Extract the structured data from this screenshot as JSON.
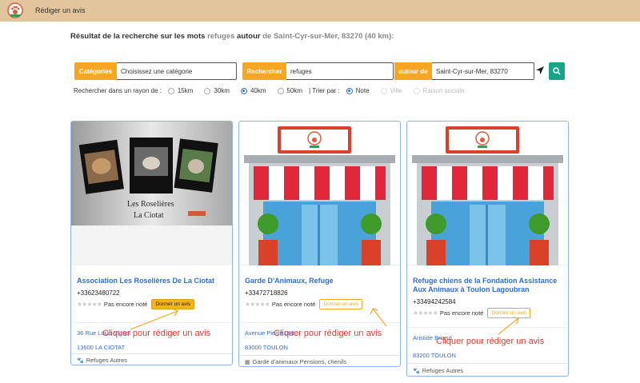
{
  "topbar": {
    "link": "Rédiger un avis",
    "accent": "#e2c59c"
  },
  "result": {
    "prefix": "Résultat de la recherche sur les mots",
    "keyword": "refuges",
    "middle": "autour",
    "place": "de Saint-Cyr-sur-Mer, 83270 (40 km):"
  },
  "search": {
    "categories_label": "Catégories",
    "categories_value": "Choisissez une catégorie",
    "search_label": "Rechercher",
    "search_value": "refuges",
    "around_label": "autour de",
    "around_value": "Saint-Cyr-sur-Mer, 83270",
    "accent": "#f5a623",
    "button_color": "#17a589"
  },
  "filters": {
    "radius_label": "Rechercher dans un rayon de :",
    "radii": [
      "15km",
      "30km",
      "40km",
      "50km"
    ],
    "radius_selected": "40km",
    "sort_label": "|  Trier par :",
    "sorts": [
      "Note",
      "Ville",
      "Raison sociale"
    ],
    "sort_selected": "Note"
  },
  "cards": [
    {
      "title": "Association Les Roselières De La Ciotat",
      "phone": "+33623480722",
      "rating_text": "Pas encore noté",
      "button": "Donner un avis",
      "street": "36 Rue Louis Vignol",
      "city": "13600 LA CIOTAT",
      "category": "Refuges Autres",
      "img_text_1": "Les Roselières",
      "img_text_2": "La Ciotat"
    },
    {
      "title": "Garde D'Animaux, Refuge",
      "phone": "+33472718826",
      "rating_text": "Pas encore noté",
      "button": "Donner un avis",
      "street": "Avenue Pierre Loti",
      "city": "83000 TOULON",
      "category": "Garde d'animaux Pensions, chenils"
    },
    {
      "title": "Refuge chiens de la Fondation Assistance Aux Animaux à Toulon Lagoubran",
      "phone": "+33494242584",
      "rating_text": "Pas encore noté",
      "button": "Donner un avis",
      "street": "Aristide Briand",
      "city": "83200 TOULON",
      "category": "Refuges Autres"
    }
  ],
  "annotation": "Cliquer pour rédiger un avis"
}
